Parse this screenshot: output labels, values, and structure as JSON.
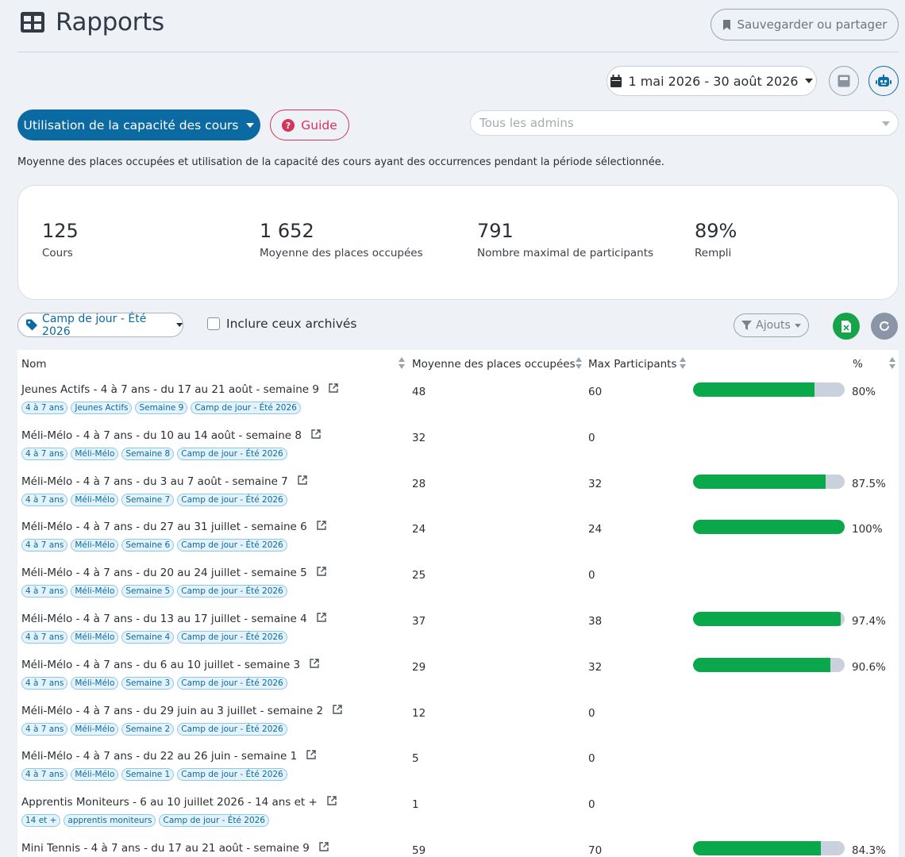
{
  "header": {
    "title": "Rapports",
    "save_label": "Sauvegarder ou partager"
  },
  "date_range": "1 mai 2026 - 30 août 2026",
  "report_selector": "Utilisation de la capacité des cours",
  "guide_label": "Guide",
  "admin_placeholder": "Tous les admins",
  "description": "Moyenne des places occupées et utilisation de la capacité des cours ayant des occurrences pendant la période sélectionnée.",
  "stats": [
    {
      "value": "125",
      "label": "Cours"
    },
    {
      "value": "1 652",
      "label": "Moyenne des places occupées"
    },
    {
      "value": "791",
      "label": "Nombre maximal de participants"
    },
    {
      "value": "89%",
      "label": "Rempli"
    }
  ],
  "filters": {
    "tag": "Camp de jour - Été 2026",
    "archived_label": "Inclure ceux archivés",
    "ajouts_label": "Ajouts"
  },
  "table": {
    "columns": [
      "Nom",
      "Moyenne des places occupées",
      "Max Participants",
      "%"
    ],
    "rows": [
      {
        "name": "Jeunes Actifs - 4 à 7 ans - du 17 au 21 août - semaine 9",
        "tags": [
          "4 à 7 ans",
          "Jeunes Actifs",
          "Semaine 9",
          "Camp de jour - Été 2026"
        ],
        "avg": "48",
        "max": "60",
        "pct": "80%",
        "fill": 0.8
      },
      {
        "name": "Méli-Mélo - 4 à 7 ans - du 10 au 14 août - semaine 8",
        "tags": [
          "4 à 7 ans",
          "Méli-Mélo",
          "Semaine 8",
          "Camp de jour - Été 2026"
        ],
        "avg": "32",
        "max": "0",
        "pct": "",
        "fill": null
      },
      {
        "name": "Méli-Mélo - 4 à 7 ans - du 3 au 7 août - semaine 7",
        "tags": [
          "4 à 7 ans",
          "Méli-Mélo",
          "Semaine 7",
          "Camp de jour - Été 2026"
        ],
        "avg": "28",
        "max": "32",
        "pct": "87.5%",
        "fill": 0.875
      },
      {
        "name": "Méli-Mélo - 4 à 7 ans - du 27 au 31 juillet - semaine 6",
        "tags": [
          "4 à 7 ans",
          "Méli-Mélo",
          "Semaine 6",
          "Camp de jour - Été 2026"
        ],
        "avg": "24",
        "max": "24",
        "pct": "100%",
        "fill": 1.0
      },
      {
        "name": "Méli-Mélo - 4 à 7 ans - du 20 au 24 juillet - semaine 5",
        "tags": [
          "4 à 7 ans",
          "Méli-Mélo",
          "Semaine 5",
          "Camp de jour - Été 2026"
        ],
        "avg": "25",
        "max": "0",
        "pct": "",
        "fill": null
      },
      {
        "name": "Méli-Mélo - 4 à 7 ans - du 13 au 17 juillet - semaine 4",
        "tags": [
          "4 à 7 ans",
          "Méli-Mélo",
          "Semaine 4",
          "Camp de jour - Été 2026"
        ],
        "avg": "37",
        "max": "38",
        "pct": "97.4%",
        "fill": 0.974
      },
      {
        "name": "Méli-Mélo - 4 à 7 ans - du 6 au 10 juillet - semaine 3",
        "tags": [
          "4 à 7 ans",
          "Méli-Mélo",
          "Semaine 3",
          "Camp de jour - Été 2026"
        ],
        "avg": "29",
        "max": "32",
        "pct": "90.6%",
        "fill": 0.906
      },
      {
        "name": "Méli-Mélo - 4 à 7 ans - du 29 juin au 3 juillet - semaine 2",
        "tags": [
          "4 à 7 ans",
          "Méli-Mélo",
          "Semaine 2",
          "Camp de jour - Été 2026"
        ],
        "avg": "12",
        "max": "0",
        "pct": "",
        "fill": null
      },
      {
        "name": "Méli-Mélo - 4 à 7 ans - du 22 au 26 juin - semaine 1",
        "tags": [
          "4 à 7 ans",
          "Méli-Mélo",
          "Semaine 1",
          "Camp de jour - Été 2026"
        ],
        "avg": "5",
        "max": "0",
        "pct": "",
        "fill": null
      },
      {
        "name": "Apprentis Moniteurs - 6 au 10 juillet 2026 - 14 ans et +",
        "tags": [
          "14 et +",
          "apprentis moniteurs",
          "Camp de jour - Été 2026"
        ],
        "avg": "1",
        "max": "0",
        "pct": "",
        "fill": null
      },
      {
        "name": "Mini Tennis - 4 à 7 ans - du 17 au 21 août - semaine 9",
        "tags": [],
        "avg": "59",
        "max": "70",
        "pct": "84.3%",
        "fill": 0.843
      }
    ]
  },
  "colors": {
    "primary": "#0b6aa2",
    "guide": "#d6335a",
    "bar_fill": "#0aa84a",
    "bar_track": "#c9d2dc",
    "excel": "#17a34a",
    "refresh": "#8a96a8"
  }
}
